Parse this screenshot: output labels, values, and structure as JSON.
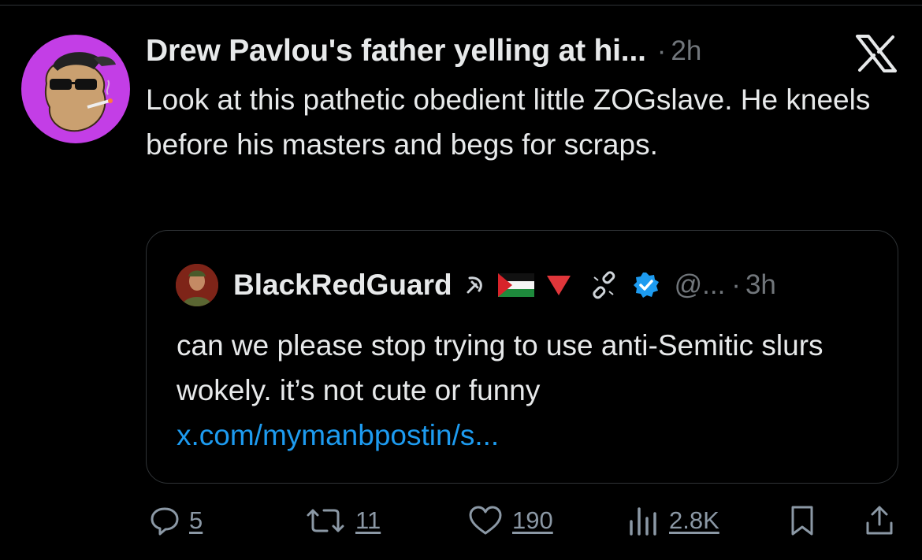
{
  "post": {
    "author": "Drew Pavlou's father yelling at hi...",
    "separator": "·",
    "time": "2h",
    "text": "Look at this pathetic obedient little ZOGslave. He kneels before his masters and begs for scraps."
  },
  "quote": {
    "author": "BlackRedGuard",
    "handle": "@...",
    "separator": "·",
    "time": "3h",
    "text": "can we please stop trying to use anti-Semitic slurs wokely. it’s not cute or funny",
    "link": "x.com/mymanbpostin/s..."
  },
  "actions": {
    "replies": "5",
    "reposts": "11",
    "likes": "190",
    "views": "2.8K"
  },
  "icons": {
    "brand": "x-logo-icon",
    "reply": "reply-icon",
    "repost": "repost-icon",
    "like": "heart-icon",
    "views": "views-icon",
    "bookmark": "bookmark-icon",
    "share": "share-icon",
    "verified": "verified-badge-icon"
  },
  "colors": {
    "background": "#000000",
    "text": "#e7e9ea",
    "muted": "#71767b",
    "link": "#1d9bf0",
    "border": "#2f3336",
    "avatar_bg": "#c33ee6"
  }
}
